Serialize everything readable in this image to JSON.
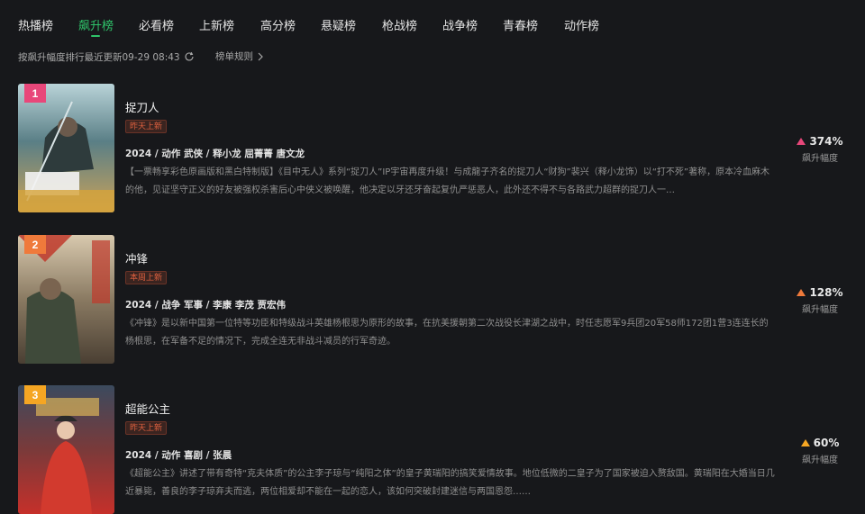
{
  "tabs": [
    {
      "label": "热播榜"
    },
    {
      "label": "飙升榜"
    },
    {
      "label": "必看榜"
    },
    {
      "label": "上新榜"
    },
    {
      "label": "高分榜"
    },
    {
      "label": "悬疑榜"
    },
    {
      "label": "枪战榜"
    },
    {
      "label": "战争榜"
    },
    {
      "label": "青春榜"
    },
    {
      "label": "动作榜"
    }
  ],
  "active_tab": "飙升榜",
  "subbar": {
    "update_text": "按飙升幅度排行最近更新09-29 08:43",
    "refresh_icon": "refresh-icon",
    "rules_label": "榜单规则",
    "rules_icon": "chevron-right-icon"
  },
  "colors": {
    "accent": "#2fc46a",
    "rank1": "#e8477a",
    "rank2": "#ef7a3b",
    "rank3": "#f5a623",
    "tag_text": "#e0613f"
  },
  "items": [
    {
      "rank": "1",
      "title": "捉刀人",
      "tag": "昨天上新",
      "meta": "2024 / 动作 武侠 / 释小龙 屈菁菁 唐文龙",
      "desc": "【一票畅享彩色原画版和黑白特制版】《目中无人》系列“捉刀人”IP宇宙再度升级！与成龍子齐名的捉刀人“财狗”裴兴（释小龙饰）以“打不死”著称，原本冷血麻木的他，见证坚守正义的好友被强权杀害后心中侠义被唤醒，他决定以牙还牙奋起复仇严惩恶人，此外还不得不与各路武力超群的捉刀人一…",
      "change": "374%",
      "change_label": "飙升幅度"
    },
    {
      "rank": "2",
      "title": "冲锋",
      "tag": "本周上新",
      "meta": "2024 / 战争 军事 / 李康 李茂 贾宏伟",
      "desc": "《冲锋》是以新中国第一位特等功臣和特级战斗英雄杨根思为原形的故事，在抗美援朝第二次战役长津湖之战中，时任志愿军9兵团20军58师172团1营3连连长的杨根思，在军备不足的情况下，完成全连无非战斗减员的行军奇迹。",
      "change": "128%",
      "change_label": "飙升幅度"
    },
    {
      "rank": "3",
      "title": "超能公主",
      "tag": "昨天上新",
      "meta": "2024 / 动作 喜剧 / 张晨",
      "desc": "《超能公主》讲述了带有奇特“克夫体质”的公主李子琼与“纯阳之体”的皇子黄瑞阳的搞笑爱情故事。地位低微的二皇子为了国家被迫入赘敌国。黄瑞阳在大婚当日几近暴毙，善良的李子琼弃夫而逃，两位相爱却不能在一起的恋人，该如何突破封建迷信与两国恩怨……",
      "change": "60%",
      "change_label": "飙升幅度"
    }
  ]
}
